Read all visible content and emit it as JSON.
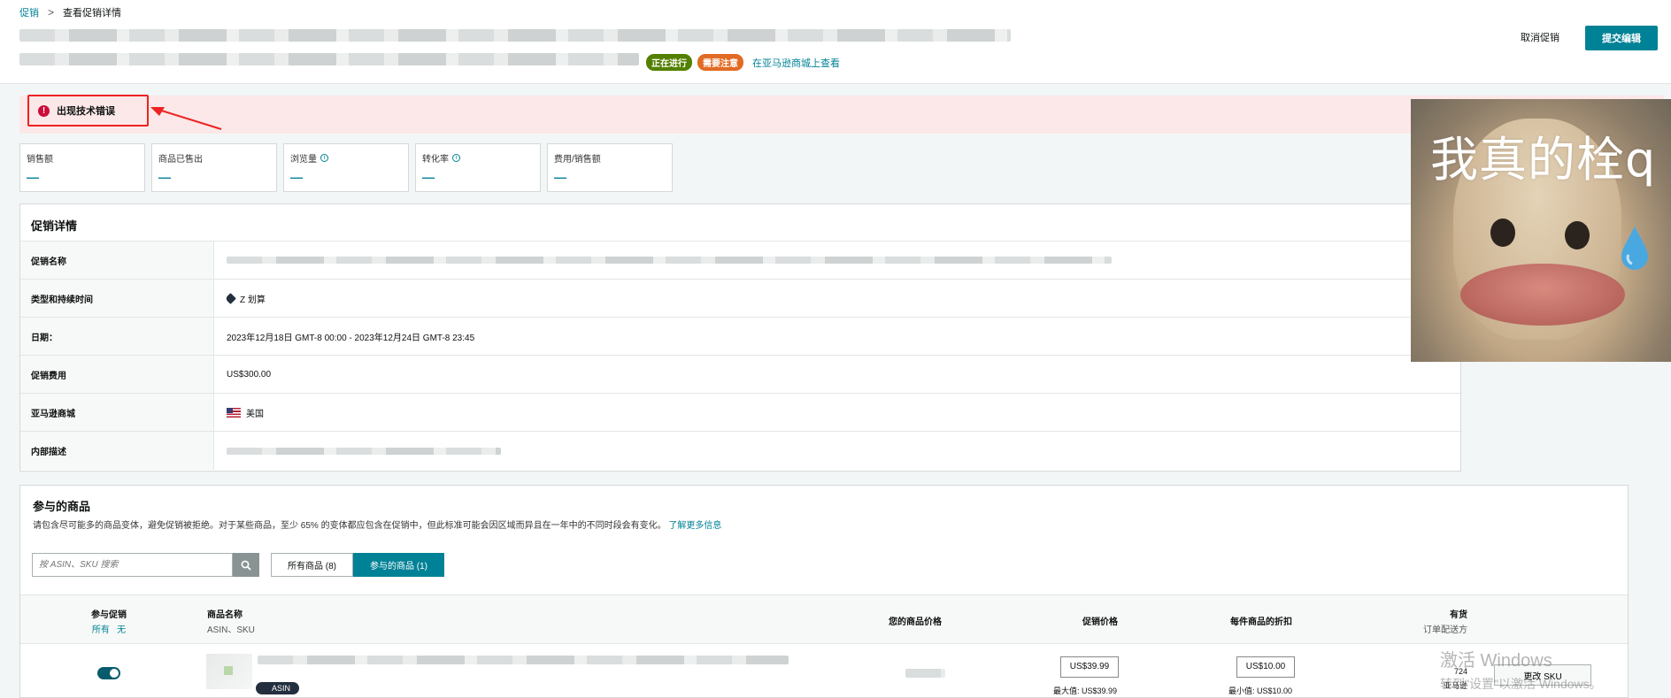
{
  "breadcrumb": {
    "root": "促销",
    "sep": ">",
    "current": "查看促销详情"
  },
  "header": {
    "badge_running": "正在进行",
    "badge_attention": "需要注意",
    "view_link": "在亚马逊商城上查看",
    "cancel_label": "取消促销",
    "submit_label": "提交编辑"
  },
  "error": {
    "icon": "!",
    "text": "出现技术错误"
  },
  "metrics": [
    {
      "label": "销售额",
      "value": "—",
      "info": false
    },
    {
      "label": "商品已售出",
      "value": "—",
      "info": false
    },
    {
      "label": "浏览量",
      "value": "—",
      "info": true
    },
    {
      "label": "转化率",
      "value": "—",
      "info": true
    },
    {
      "label": "费用/销售额",
      "value": "—",
      "info": false
    }
  ],
  "details": {
    "title": "促销详情",
    "rows": [
      {
        "key": "促销名称",
        "value": ""
      },
      {
        "key": "类型和持续时间",
        "value": "Z 划算"
      },
      {
        "key": "日期：",
        "value": "2023年12月18日 GMT-8 00:00 - 2023年12月24日 GMT-8 23:45"
      },
      {
        "key": "促销费用",
        "value": "US$300.00"
      },
      {
        "key": "亚马逊商城",
        "value": "美国"
      },
      {
        "key": "内部描述",
        "value": ""
      }
    ]
  },
  "products": {
    "title": "参与的商品",
    "desc": "请包含尽可能多的商品变体，避免促销被拒绝。对于某些商品，至少 65% 的变体都应包含在促销中，但此标准可能会因区域而异且在一年中的不同时段会有变化。",
    "learn_more": "了解更多信息",
    "search_placeholder": "按 ASIN、SKU 搜索",
    "tab_all": "所有商品 (8)",
    "tab_participating": "参与的商品 (1)",
    "columns": {
      "participate": "参与促销",
      "participate_all": "所有",
      "participate_none": "无",
      "name": "商品名称",
      "name_sub": "ASIN、SKU",
      "your_price": "您的商品价格",
      "promo_price": "促销价格",
      "discount": "每件商品的折扣",
      "stock": "有货",
      "stock_sub": "订单配送方"
    },
    "row": {
      "asin_label": "ASIN",
      "promo_price": "US$39.99",
      "promo_max": "最大值: US$39.99",
      "discount": "US$10.00",
      "discount_min": "最小值: US$10.00",
      "stock_qty": "724",
      "stock_by": "亚马逊",
      "edit_sku": "更改 SKU",
      "participating": true
    }
  },
  "meme": {
    "caption": "我真的栓q"
  },
  "watermark": {
    "line1": "激活 Windows",
    "line2": "转到\"设置\"以激活 Windows。"
  },
  "colors": {
    "accent": "#008296",
    "badge_running": "#538000",
    "badge_attention": "#e26b24",
    "error_bg": "#fce8e8",
    "error_border": "#ee2222"
  }
}
